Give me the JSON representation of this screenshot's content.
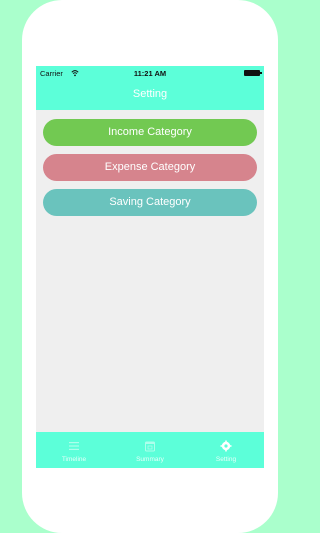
{
  "status_bar": {
    "carrier": "Carrier",
    "time": "11:21 AM",
    "wifi_icon": "wifi-icon",
    "battery_icon": "battery-icon"
  },
  "nav_bar": {
    "title": "Setting"
  },
  "settings": {
    "items": [
      {
        "label": "Income Category",
        "color": "#72c952"
      },
      {
        "label": "Expense Category",
        "color": "#d6848d"
      },
      {
        "label": "Saving Category",
        "color": "#6ac3bd"
      }
    ]
  },
  "tab_bar": {
    "tabs": [
      {
        "label": "Timeline",
        "icon": "list-icon",
        "active": false
      },
      {
        "label": "Summary",
        "icon": "calendar-icon",
        "active": false
      },
      {
        "label": "Setting",
        "icon": "gear-icon",
        "active": true
      }
    ]
  },
  "colors": {
    "page_background": "#aaffcc",
    "accent": "#5cffd9",
    "content_background": "#efefef"
  }
}
